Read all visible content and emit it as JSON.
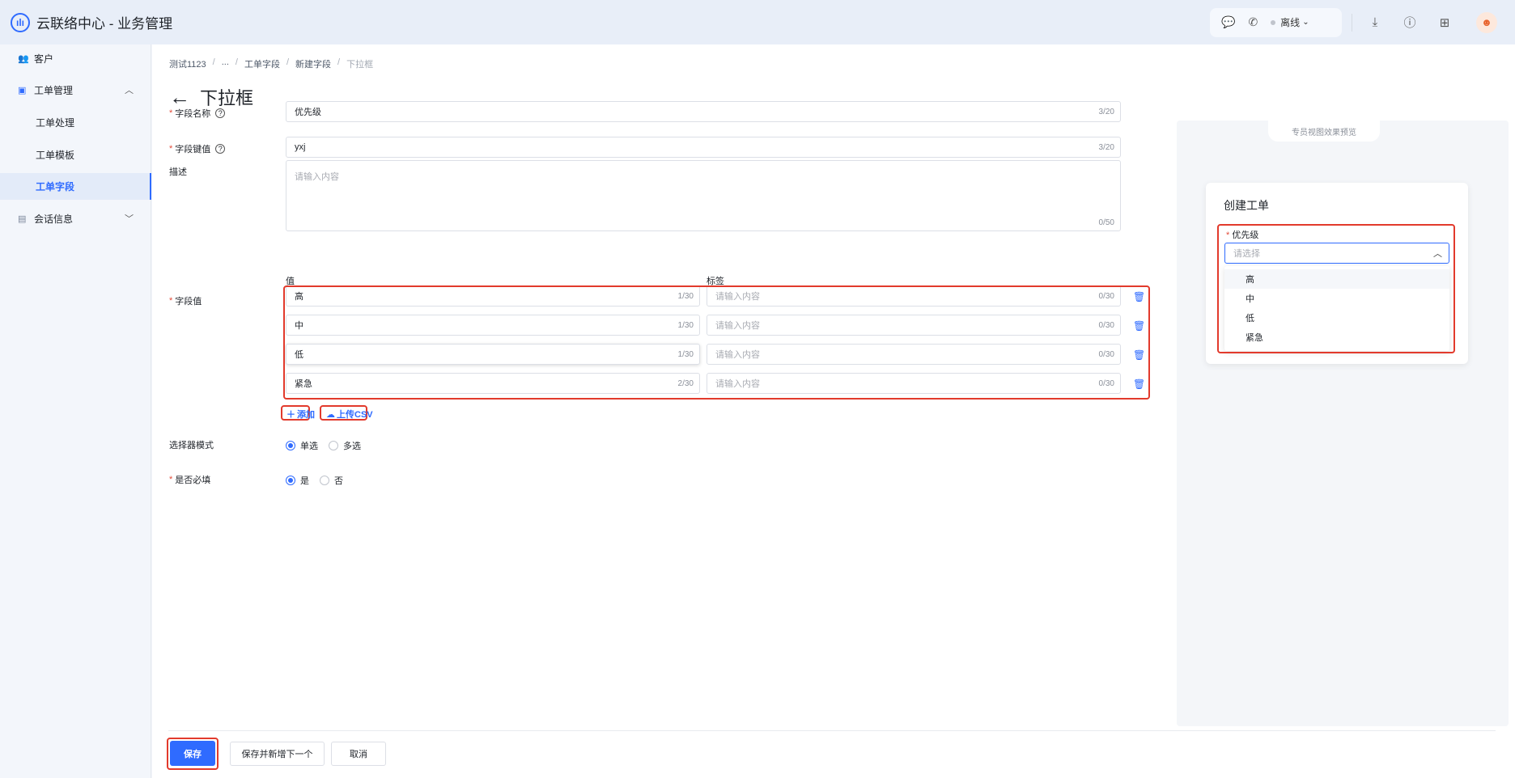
{
  "app": {
    "title": "云联络中心 - 业务管理",
    "logo_icon": "headset-wave-icon"
  },
  "topbar": {
    "status": "离线",
    "icons": [
      "chat-icon",
      "phone-icon",
      "download-icon",
      "help-icon",
      "grid-icon"
    ],
    "avatar_icon": "user-avatar"
  },
  "sidebar": {
    "items": [
      {
        "label": "客户"
      },
      {
        "label": "工单管理"
      },
      {
        "label": "工单处理"
      },
      {
        "label": "工单模板"
      },
      {
        "label": "工单字段"
      },
      {
        "label": "会话信息"
      }
    ]
  },
  "breadcrumb": [
    "测试1123",
    "...",
    "工单字段",
    "新建字段",
    "下拉框"
  ],
  "page": {
    "title": "下拉框"
  },
  "form": {
    "name_label": "字段名称",
    "name_value": "优先级",
    "name_count": "3/20",
    "key_label": "字段键值",
    "key_value": "yxj",
    "key_count": "3/20",
    "desc_label": "描述",
    "desc_placeholder": "请输入内容",
    "desc_count": "0/50",
    "values_label": "字段值",
    "col_value": "值",
    "col_label": "标签",
    "rows": [
      {
        "value": "高",
        "count": "1/30",
        "label_placeholder": "请输入内容",
        "label_count": "0/30"
      },
      {
        "value": "中",
        "count": "1/30",
        "label_placeholder": "请输入内容",
        "label_count": "0/30"
      },
      {
        "value": "低",
        "count": "1/30",
        "label_placeholder": "请输入内容",
        "label_count": "0/30"
      },
      {
        "value": "紧急",
        "count": "2/30",
        "label_placeholder": "请输入内容",
        "label_count": "0/30"
      }
    ],
    "add_label": "添加",
    "upload_label": "上传CSV",
    "mode_label": "选择器模式",
    "mode_single": "单选",
    "mode_multi": "多选",
    "required_label": "是否必填",
    "required_yes": "是",
    "required_no": "否"
  },
  "preview": {
    "tab": "专员视图效果预览",
    "card_title": "创建工单",
    "field_label": "优先级",
    "placeholder": "请选择",
    "options": [
      "高",
      "中",
      "低",
      "紧急"
    ]
  },
  "footer": {
    "save": "保存",
    "save_next": "保存并新增下一个",
    "cancel": "取消"
  },
  "colors": {
    "accent": "#2f6bff",
    "highlight": "#e23a2c",
    "required": "#e34d3b"
  }
}
